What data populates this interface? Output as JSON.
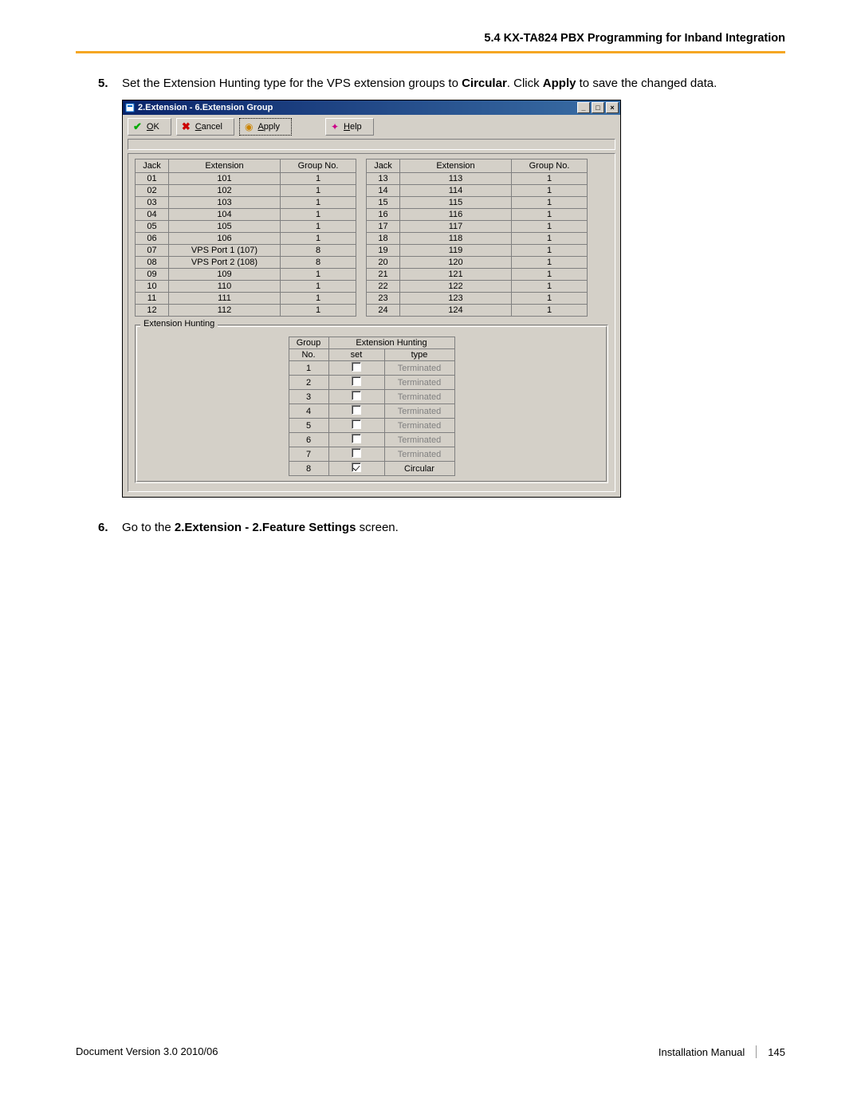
{
  "header": {
    "section": "5.4 KX-TA824 PBX Programming for Inband Integration"
  },
  "steps": {
    "s5": {
      "num": "5.",
      "pre": "Set the Extension Hunting type for the VPS extension groups to ",
      "bold1": "Circular",
      "mid": ". Click ",
      "bold2": "Apply",
      "post": " to save the changed data."
    },
    "s6": {
      "num": "6.",
      "pre": "Go to the ",
      "bold1": "2.Extension - 2.Feature Settings",
      "post": " screen."
    }
  },
  "window": {
    "title": "2.Extension - 6.Extension Group",
    "buttons": {
      "ok": "OK",
      "cancel": "Cancel",
      "apply": "Apply",
      "help": "Help"
    },
    "table_headers": {
      "jack": "Jack",
      "extension": "Extension",
      "group": "Group No."
    },
    "left_rows": [
      {
        "jack": "01",
        "ext": "101",
        "grp": "1"
      },
      {
        "jack": "02",
        "ext": "102",
        "grp": "1"
      },
      {
        "jack": "03",
        "ext": "103",
        "grp": "1"
      },
      {
        "jack": "04",
        "ext": "104",
        "grp": "1"
      },
      {
        "jack": "05",
        "ext": "105",
        "grp": "1"
      },
      {
        "jack": "06",
        "ext": "106",
        "grp": "1"
      },
      {
        "jack": "07",
        "ext": "VPS Port 1 (107)",
        "grp": "8"
      },
      {
        "jack": "08",
        "ext": "VPS Port 2 (108)",
        "grp": "8"
      },
      {
        "jack": "09",
        "ext": "109",
        "grp": "1"
      },
      {
        "jack": "10",
        "ext": "110",
        "grp": "1"
      },
      {
        "jack": "11",
        "ext": "111",
        "grp": "1"
      },
      {
        "jack": "12",
        "ext": "112",
        "grp": "1"
      }
    ],
    "right_rows": [
      {
        "jack": "13",
        "ext": "113",
        "grp": "1"
      },
      {
        "jack": "14",
        "ext": "114",
        "grp": "1"
      },
      {
        "jack": "15",
        "ext": "115",
        "grp": "1"
      },
      {
        "jack": "16",
        "ext": "116",
        "grp": "1"
      },
      {
        "jack": "17",
        "ext": "117",
        "grp": "1"
      },
      {
        "jack": "18",
        "ext": "118",
        "grp": "1"
      },
      {
        "jack": "19",
        "ext": "119",
        "grp": "1"
      },
      {
        "jack": "20",
        "ext": "120",
        "grp": "1"
      },
      {
        "jack": "21",
        "ext": "121",
        "grp": "1"
      },
      {
        "jack": "22",
        "ext": "122",
        "grp": "1"
      },
      {
        "jack": "23",
        "ext": "123",
        "grp": "1"
      },
      {
        "jack": "24",
        "ext": "124",
        "grp": "1"
      }
    ],
    "hunting": {
      "legend": "Extension Hunting",
      "headers": {
        "group_top": "Group",
        "group_bot": "No.",
        "eh_top": "Extension Hunting",
        "set": "set",
        "type": "type"
      },
      "rows": [
        {
          "grp": "1",
          "checked": false,
          "type": "Terminated"
        },
        {
          "grp": "2",
          "checked": false,
          "type": "Terminated"
        },
        {
          "grp": "3",
          "checked": false,
          "type": "Terminated"
        },
        {
          "grp": "4",
          "checked": false,
          "type": "Terminated"
        },
        {
          "grp": "5",
          "checked": false,
          "type": "Terminated"
        },
        {
          "grp": "6",
          "checked": false,
          "type": "Terminated"
        },
        {
          "grp": "7",
          "checked": false,
          "type": "Terminated"
        },
        {
          "grp": "8",
          "checked": true,
          "type": "Circular"
        }
      ]
    }
  },
  "footer": {
    "left": "Document Version  3.0  2010/06",
    "manual": "Installation Manual",
    "page": "145"
  }
}
